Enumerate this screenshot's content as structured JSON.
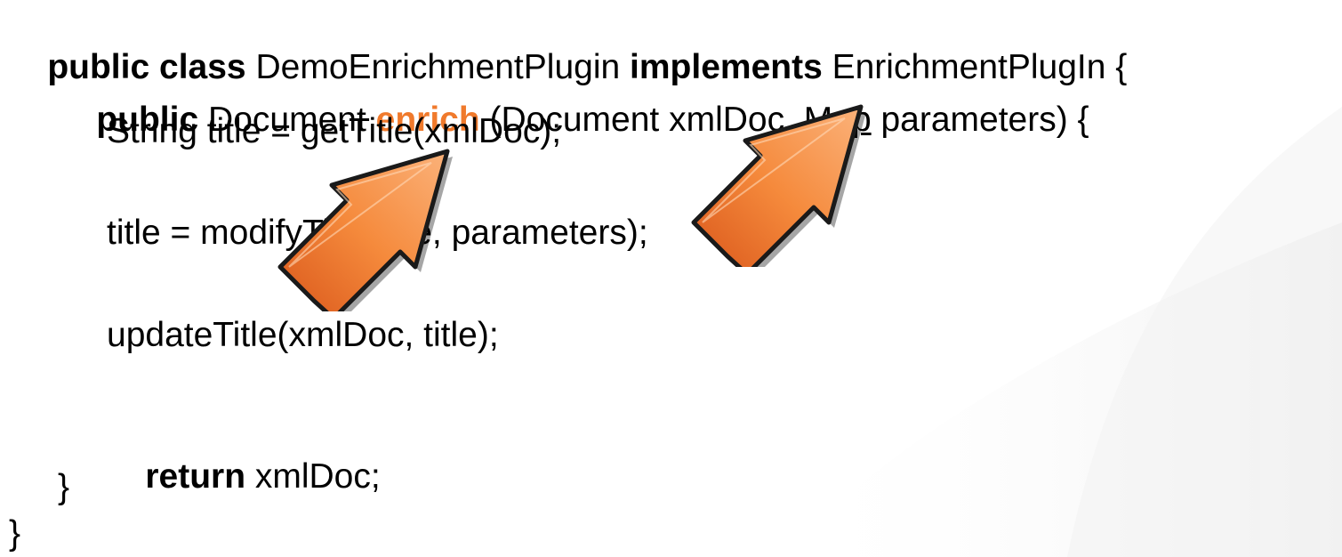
{
  "colors": {
    "text": "#000000",
    "method_highlight": "#f07a2c",
    "arrow_fill": "#f27a2a",
    "arrow_outline": "#1a1a1a"
  },
  "code": {
    "line1": {
      "kw_public": "public",
      "kw_class": "class",
      "class_name": "DemoEnrichmentPlugin",
      "kw_implements": "implements",
      "interface_name": "EnrichmentPlugIn",
      "brace": "{"
    },
    "line2": {
      "kw_public": "public",
      "return_type": "Document",
      "method_name": "enrich",
      "params_open": "(Document xmlDoc, ",
      "map_type": "Map",
      "params_close": " parameters) {"
    },
    "line3": "String title = getTitle(xmlDoc);",
    "line4": "title = modifyTitle(title, parameters);",
    "line5": "updateTitle(xmlDoc, title);",
    "line6": {
      "kw_return": "return",
      "rest": " xmlDoc;"
    },
    "line7": "}",
    "line8": "}"
  },
  "icons": [
    "arrow-icon",
    "arrow-icon"
  ]
}
